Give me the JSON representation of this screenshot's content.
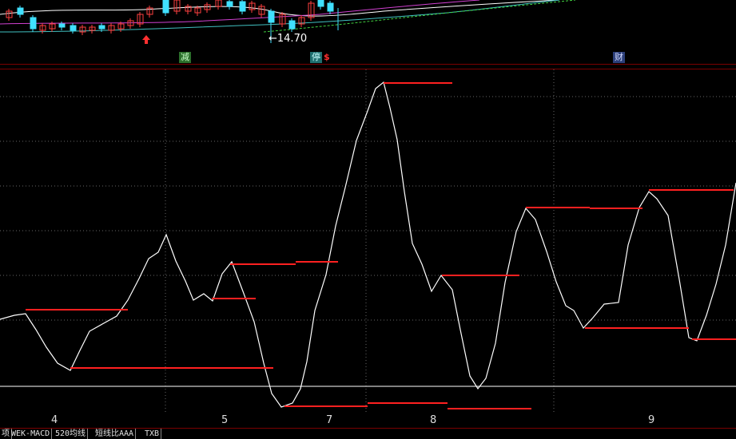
{
  "price_pane": {
    "price_label": "←14.70",
    "badges": {
      "jian": "减",
      "ting": "停",
      "s": "$",
      "cai": "财"
    },
    "colors": {
      "up": "#ff4040",
      "down": "#40e0ff",
      "ma_white": "#ffffff",
      "ma_magenta": "#d040d0",
      "ma_cyan": "#40c0c0",
      "ma_green": "#40d040"
    }
  },
  "oscillator": {
    "line_color": "#ffffff",
    "level_color": "#ff2020",
    "baseline_color": "#ffffff",
    "grid_color": "#666666"
  },
  "x_axis": {
    "labels": [
      "4",
      "5",
      "7",
      "8",
      "9"
    ]
  },
  "tabs": [
    "项",
    "WEK-MACD",
    "520均线",
    "短线比AAA",
    "TXB"
  ]
}
